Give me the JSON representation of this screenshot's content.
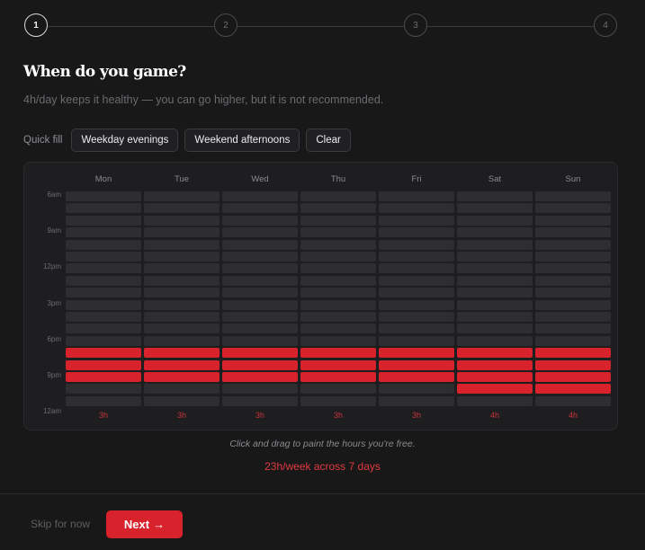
{
  "stepper": {
    "steps": [
      {
        "label": "1",
        "active": true
      },
      {
        "label": "2",
        "active": false
      },
      {
        "label": "3",
        "active": false
      },
      {
        "label": "4",
        "active": false
      }
    ]
  },
  "header": {
    "title": "When do you game?",
    "subtitle": "4h/day keeps it healthy — you can go higher, but it is not recommended."
  },
  "quick_fill": {
    "label": "Quick fill",
    "buttons": [
      "Weekday evenings",
      "Weekend afternoons",
      "Clear"
    ]
  },
  "schedule": {
    "days": [
      "Mon",
      "Tue",
      "Wed",
      "Thu",
      "Fri",
      "Sat",
      "Sun"
    ],
    "time_labels": [
      "6am",
      "9am",
      "12pm",
      "3pm",
      "6pm",
      "9pm",
      "12am"
    ],
    "slot_count": 18,
    "selected_slots": {
      "Mon": [
        13,
        14,
        15
      ],
      "Tue": [
        13,
        14,
        15
      ],
      "Wed": [
        13,
        14,
        15
      ],
      "Thu": [
        13,
        14,
        15
      ],
      "Fri": [
        13,
        14,
        15
      ],
      "Sat": [
        13,
        14,
        15,
        16
      ],
      "Sun": [
        13,
        14,
        15,
        16
      ]
    },
    "day_totals": [
      "3h",
      "3h",
      "3h",
      "3h",
      "3h",
      "4h",
      "4h"
    ]
  },
  "hint": "Click and drag to paint the hours you're free.",
  "summary": "23h/week across 7 days",
  "footer": {
    "skip_label": "Skip for now",
    "next_label": "Next",
    "next_arrow": "→"
  },
  "colors": {
    "accent": "#d8222c",
    "cell_empty": "#2e2e31",
    "background": "#181819"
  }
}
